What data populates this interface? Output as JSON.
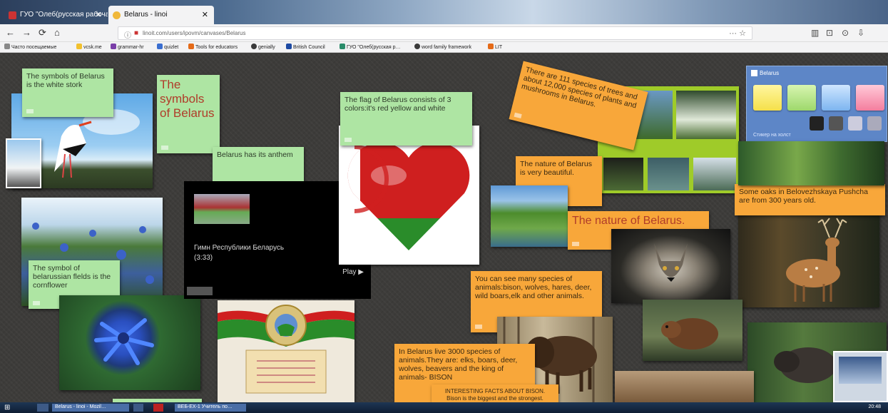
{
  "browser": {
    "tabs": [
      {
        "label": "ГУО \"Олеб(русская рабочая…",
        "close": "✕"
      },
      {
        "label": "Belarus - linoi",
        "close": "✕"
      }
    ],
    "nav": {
      "back": "←",
      "forward": "→",
      "reload": "⟳",
      "home": "⌂"
    },
    "url": "linoit.com/users/ipovm/canvases/Belarus",
    "url_more": "··· ☆",
    "right_icons": [
      "▥",
      "⊡",
      "⊙",
      "⇩"
    ],
    "bookmarks": [
      "Часто посещаемые",
      "vcsk.me",
      "grammar-hr",
      "quizlet",
      "Tools for educators",
      "genially",
      "British Council",
      "ГУО \"Олеб(русская р…",
      "word family framework",
      "LIT"
    ]
  },
  "canvas": {
    "notes": {
      "stork": "The symbols of Belarus is the white stork",
      "symbols": "The symbols of Belarus",
      "anthem": "Belarus has its anthem",
      "flag": "The flag of Belarus consists of 3 colors:it's red yellow and white",
      "cornflower": "The symbol of belarussian flelds is the cornflower",
      "trees": "There are 111 species of trees and about 12,000 species of plants and mushrooms in Belarus.",
      "nature_beautiful": "The nature of Belarus is very beautiful.",
      "nature_title": "The nature of Belarus.",
      "oaks": "Some oaks in Belovezhskaya Pushcha are from 300 years old.",
      "animals": "You can see many species of animals:bison, wolves, hares, deer, wild boars,elk and other animals.",
      "species": "In Belarus live 3000 species of animals.They are: elks, boars, deer, wolves, beavers and the king of animals- BISON",
      "bison_facts": "INTERESTING FACTS ABOUT BISON.",
      "bison_facts_sub": "Bison is the biggest and the strongest."
    },
    "video": {
      "title": "Гимн Республики Беларусь",
      "duration": "(3:33)",
      "play": "Play ▶"
    },
    "widget": {
      "title": "Belarus",
      "link": "Стикер на холст"
    },
    "colors": {
      "green_note": "#aee5a3",
      "orange_note": "#f8a73a",
      "flag_red": "#cf1f1f",
      "flag_green": "#2a8c2a"
    }
  },
  "taskbar": {
    "items": [
      "Belarus - linoi - Mozil…",
      "ВЕБ-ЕХ-1 Учитель по…"
    ],
    "clock": "20:48"
  }
}
